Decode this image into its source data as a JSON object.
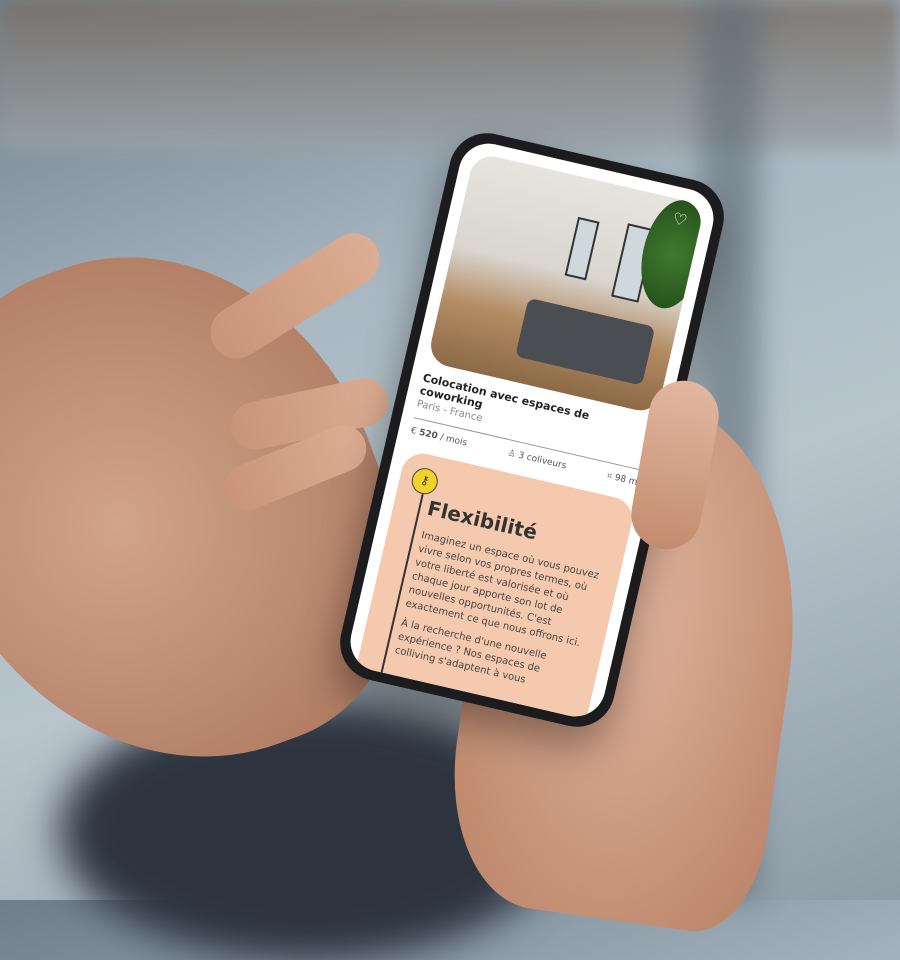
{
  "listing": {
    "title": "Colocation avec espaces de coworking",
    "location": "Paris - France",
    "price_icon": "euro-icon",
    "price": "520",
    "price_unit": "/ mois",
    "people_icon": "person-icon",
    "people": "3 coliveurs",
    "area_icon": "area-icon",
    "area": "98 m²"
  },
  "feature_card": {
    "icon": "key-icon",
    "title": "Flexibilité",
    "paragraph1": "Imaginez un espace où vous pouvez vivre selon vos propres termes, où votre liberté est valorisée et où chaque jour apporte son lot de nouvelles opportunités. C'est exactement ce que nous offrons ici.",
    "paragraph2": "À la recherche d'une nouvelle expérience ? Nos espaces de colliving s'adaptent à vous",
    "background": "#f5c9ae",
    "accent": "#f2d12c"
  }
}
